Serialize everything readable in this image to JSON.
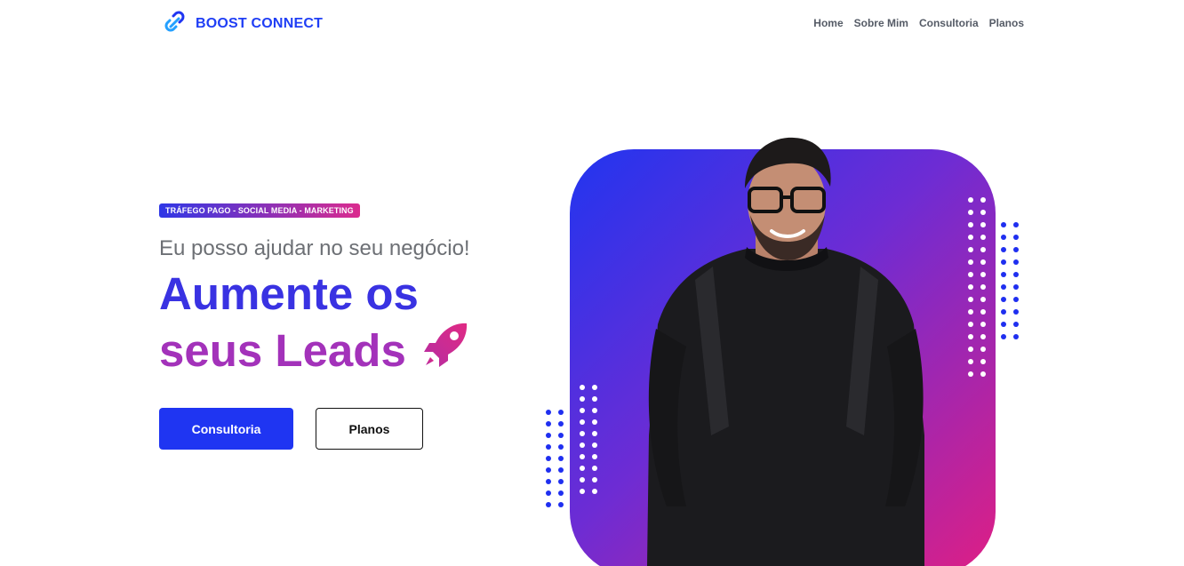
{
  "header": {
    "brand": "BOOST CONNECT",
    "nav": [
      "Home",
      "Sobre Mim",
      "Consultoria",
      "Planos"
    ]
  },
  "hero": {
    "badge": "TRÁFEGO PAGO - SOCIAL MEDIA - MARKETING",
    "subtitle": "Eu posso ajudar no seu negócio!",
    "headline_line1": "Aumente os",
    "headline_line2": "seus Leads",
    "primary_button": "Consultoria",
    "secondary_button": "Planos"
  },
  "icons": {
    "logo": "chain-link-icon",
    "headline": "rocket-icon"
  },
  "colors": {
    "brand_blue": "#1f35f2",
    "headline_blue": "#3932e2",
    "headline_purple": "#a332ba",
    "gradient_start": "#2135f0",
    "gradient_end": "#df1f84"
  }
}
